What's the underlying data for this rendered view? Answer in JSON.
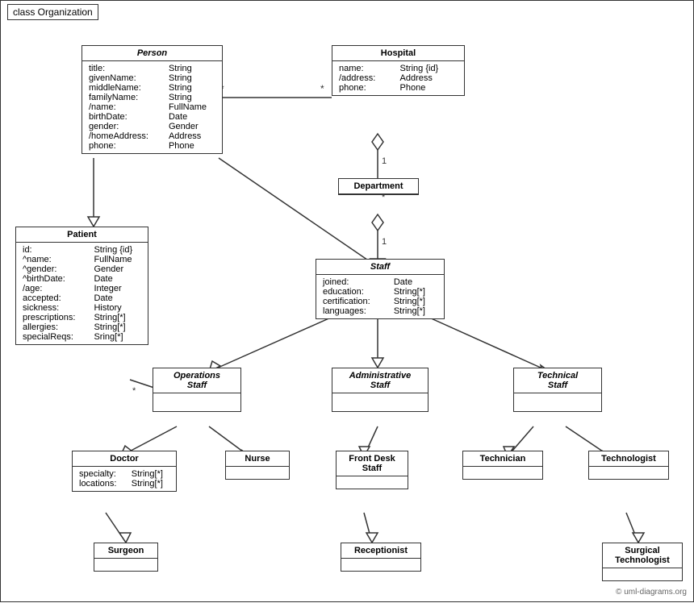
{
  "diagram": {
    "title": "class Organization",
    "copyright": "© uml-diagrams.org",
    "classes": {
      "Person": {
        "title": "Person",
        "italic": true,
        "attributes": [
          [
            "title:",
            "String"
          ],
          [
            "givenName:",
            "String"
          ],
          [
            "middleName:",
            "String"
          ],
          [
            "familyName:",
            "String"
          ],
          [
            "/name:",
            "FullName"
          ],
          [
            "birthDate:",
            "Date"
          ],
          [
            "gender:",
            "Gender"
          ],
          [
            "/homeAddress:",
            "Address"
          ],
          [
            "phone:",
            "Phone"
          ]
        ]
      },
      "Hospital": {
        "title": "Hospital",
        "italic": false,
        "attributes": [
          [
            "name:",
            "String {id}"
          ],
          [
            "/address:",
            "Address"
          ],
          [
            "phone:",
            "Phone"
          ]
        ]
      },
      "Patient": {
        "title": "Patient",
        "italic": false,
        "attributes": [
          [
            "id:",
            "String {id}"
          ],
          [
            "^name:",
            "FullName"
          ],
          [
            "^gender:",
            "Gender"
          ],
          [
            "^birthDate:",
            "Date"
          ],
          [
            "/age:",
            "Integer"
          ],
          [
            "accepted:",
            "Date"
          ],
          [
            "sickness:",
            "History"
          ],
          [
            "prescriptions:",
            "String[*]"
          ],
          [
            "allergies:",
            "String[*]"
          ],
          [
            "specialReqs:",
            "Sring[*]"
          ]
        ]
      },
      "Department": {
        "title": "Department",
        "italic": false,
        "attributes": []
      },
      "Staff": {
        "title": "Staff",
        "italic": true,
        "attributes": [
          [
            "joined:",
            "Date"
          ],
          [
            "education:",
            "String[*]"
          ],
          [
            "certification:",
            "String[*]"
          ],
          [
            "languages:",
            "String[*]"
          ]
        ]
      },
      "OperationsStaff": {
        "title": "Operations\nStaff",
        "italic": true,
        "attributes": []
      },
      "AdministrativeStaff": {
        "title": "Administrative\nStaff",
        "italic": true,
        "attributes": []
      },
      "TechnicalStaff": {
        "title": "Technical\nStaff",
        "italic": true,
        "attributes": []
      },
      "Doctor": {
        "title": "Doctor",
        "italic": false,
        "attributes": [
          [
            "specialty:",
            "String[*]"
          ],
          [
            "locations:",
            "String[*]"
          ]
        ]
      },
      "Nurse": {
        "title": "Nurse",
        "italic": false,
        "attributes": []
      },
      "FrontDeskStaff": {
        "title": "Front Desk\nStaff",
        "italic": false,
        "attributes": []
      },
      "Technician": {
        "title": "Technician",
        "italic": false,
        "attributes": []
      },
      "Technologist": {
        "title": "Technologist",
        "italic": false,
        "attributes": []
      },
      "Surgeon": {
        "title": "Surgeon",
        "italic": false,
        "attributes": []
      },
      "Receptionist": {
        "title": "Receptionist",
        "italic": false,
        "attributes": []
      },
      "SurgicalTechnologist": {
        "title": "Surgical\nTechnologist",
        "italic": false,
        "attributes": []
      }
    }
  }
}
